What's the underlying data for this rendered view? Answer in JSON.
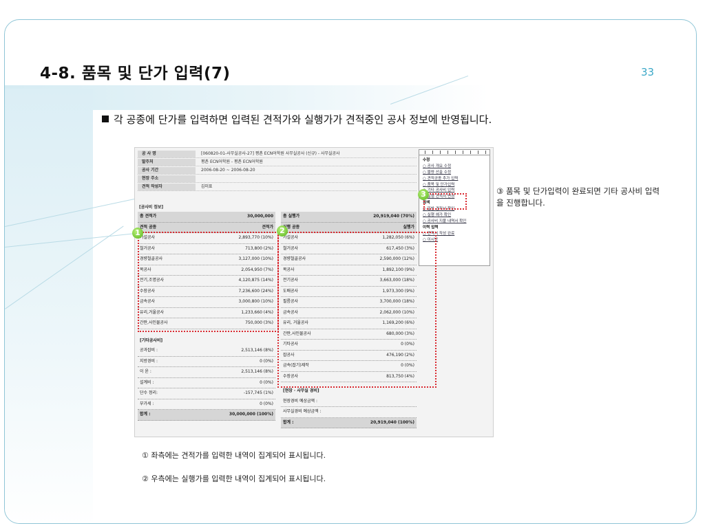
{
  "slide": {
    "title": "4-8. 품목 및 단가 입력(7)",
    "page_number": "33",
    "lead": "각 공종에 단가를 입력하면 입력된 견적가와 실행가가 견적중인 공사 정보에 반영됩니다."
  },
  "project_info": [
    {
      "key": "공 사 명",
      "value": "[060820-01-사무실공사-27] 평촌 ECN어학원 사무실공사 (신규) - 사무실공사"
    },
    {
      "key": "발주처",
      "value": "평촌 ECN어학원 - 평촌 ECN어학원"
    },
    {
      "key": "공사 기간",
      "value": "2006-08-20 ~ 2006-08-20"
    },
    {
      "key": "현장 주소",
      "value": ""
    },
    {
      "key": "견적 작성자",
      "value": "김미표"
    }
  ],
  "cost_info_label": "[공사비 정보]",
  "estimate": {
    "total_label": "총 견적가",
    "total_value": "30,000,000",
    "col_name": "견적 공종",
    "col_value": "견적가",
    "rows": [
      {
        "name": "가설공사",
        "value": "2,893,770 (10%)"
      },
      {
        "name": "철거공사",
        "value": "713,800 (2%)"
      },
      {
        "name": "경량철골공사",
        "value": "3,127,000 (10%)"
      },
      {
        "name": "목공사",
        "value": "2,054,950 (7%)"
      },
      {
        "name": "전기,조명공사",
        "value": "4,120,875 (14%)"
      },
      {
        "name": "수장공사",
        "value": "7,236,600 (24%)"
      },
      {
        "name": "금속공사",
        "value": "3,000,800 (10%)"
      },
      {
        "name": "유리,거울공사",
        "value": "1,233,660 (4%)"
      },
      {
        "name": "간판,사인물공사",
        "value": "750,000 (3%)"
      }
    ],
    "other_label": "[기타공사비]",
    "other_rows": [
      {
        "name": "공과잡비 :",
        "value": "2,513,146 (8%)"
      },
      {
        "name": "지방경비 :",
        "value": "0 (0%)"
      },
      {
        "name": "이 윤 :",
        "value": "2,513,146 (8%)"
      },
      {
        "name": "설계비 :",
        "value": "0 (0%)"
      },
      {
        "name": "단수 정리:",
        "value": "-157,745 (1%)"
      },
      {
        "name": "부가세 :",
        "value": "0 (0%)"
      }
    ],
    "sum_label": "합계 :",
    "sum_value": "30,000,000 (100%)"
  },
  "execution": {
    "total_label": "총 실행가",
    "total_value": "20,919,040 (70%)",
    "col_name": "실행 공종",
    "col_value": "실행가",
    "rows": [
      {
        "name": "가설공사",
        "value": "1,282,050 (6%)"
      },
      {
        "name": "철거공사",
        "value": "617,450 (3%)"
      },
      {
        "name": "경량철골공사",
        "value": "2,590,000 (12%)"
      },
      {
        "name": "목공사",
        "value": "1,892,100 (9%)"
      },
      {
        "name": "전기공사",
        "value": "3,663,000 (18%)"
      },
      {
        "name": "도배공사",
        "value": "1,973,300 (9%)"
      },
      {
        "name": "필름공사",
        "value": "3,700,000 (18%)"
      },
      {
        "name": "금속공사",
        "value": "2,062,000 (10%)"
      },
      {
        "name": "유리, 거울공사",
        "value": "1,169,200 (6%)"
      },
      {
        "name": "간판,사인물공사",
        "value": "680,000 (3%)"
      },
      {
        "name": "기타공사",
        "value": "0 (0%)"
      },
      {
        "name": "잡공사",
        "value": "476,190 (2%)"
      },
      {
        "name": "금속(잡기)제작",
        "value": "0 (0%)"
      },
      {
        "name": "수장공사",
        "value": "813,750 (4%)"
      }
    ],
    "site_label": "[현장 · 사무실 경비]",
    "site_rows": [
      {
        "name": "현장경비 예상금액 :",
        "value": ""
      },
      {
        "name": "사무실경비 예상금액 :",
        "value": ""
      }
    ],
    "sum_label": "합계 :",
    "sum_value": "20,919,040 (100%)"
  },
  "menu": [
    {
      "text": "수정",
      "type": "h"
    },
    {
      "text": "○ 공사 개요 수정",
      "type": "l"
    },
    {
      "text": "○ 물량 산출 수정",
      "type": "l"
    },
    {
      "text": "○ 견적공종 추가 입력",
      "type": "l"
    },
    {
      "text": "○ 품목 및 단가입력",
      "type": "l"
    },
    {
      "text": "○ 기타 공사비 입력",
      "type": "l"
    },
    {
      "text": "○ 실행 견적서 변경",
      "type": "l"
    },
    {
      "text": "검색",
      "type": "h"
    },
    {
      "text": "○ 일반 견적서 확인",
      "type": "l"
    },
    {
      "text": "○ 실행 예가 확인",
      "type": "l"
    },
    {
      "text": "○ 공사비 지불 내역서 확인",
      "type": "l"
    },
    {
      "text": "이력 입력",
      "type": "h"
    },
    {
      "text": "○ 견적서 작성 완료",
      "type": "l"
    },
    {
      "text": "○ 이시방",
      "type": "l"
    }
  ],
  "badges": [
    "1",
    "2",
    "3"
  ],
  "side_note": "③ 품목 및 단가입력이 완료되면 기타 공사비 입력을 진행합니다.",
  "captions": [
    "① 좌측에는 견적가를 입력한 내역이 집계되어 표시됩니다.",
    "② 우측에는 실행가를 입력한 내역이 집계되어 표시됩니다."
  ],
  "colors": {
    "accent": "#3aa7c7",
    "highlight": "#d9272e",
    "badge": "#58b51c"
  }
}
